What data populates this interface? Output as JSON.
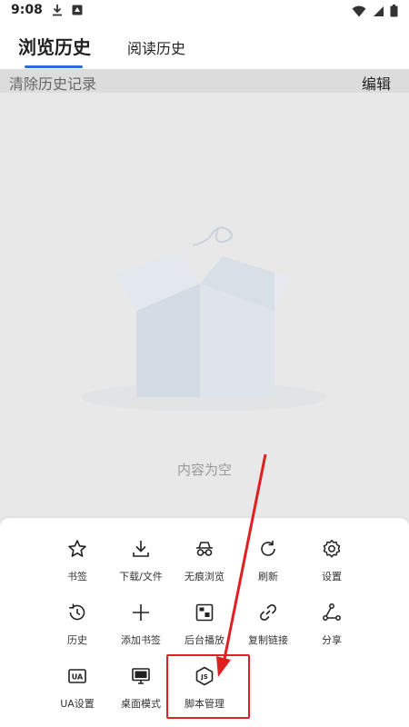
{
  "status_bar": {
    "time": "9:08"
  },
  "tabs": [
    {
      "label": "浏览历史",
      "active": true
    },
    {
      "label": "阅读历史",
      "active": false
    }
  ],
  "actionbar": {
    "clear_label": "清除历史记录",
    "edit_label": "编辑"
  },
  "empty_state": {
    "text": "内容为空"
  },
  "menu": {
    "items": [
      {
        "label": "书签",
        "icon": "star-icon"
      },
      {
        "label": "下载/文件",
        "icon": "download-icon"
      },
      {
        "label": "无痕浏览",
        "icon": "incognito-icon"
      },
      {
        "label": "刷新",
        "icon": "refresh-icon"
      },
      {
        "label": "设置",
        "icon": "gear-icon"
      },
      {
        "label": "历史",
        "icon": "history-icon"
      },
      {
        "label": "添加书签",
        "icon": "plus-icon"
      },
      {
        "label": "后台播放",
        "icon": "background-play-icon"
      },
      {
        "label": "复制链接",
        "icon": "link-icon"
      },
      {
        "label": "分享",
        "icon": "share-icon"
      },
      {
        "label": "UA设置",
        "icon": "ua-icon"
      },
      {
        "label": "桌面模式",
        "icon": "desktop-icon"
      },
      {
        "label": "脚本管理",
        "icon": "js-icon"
      }
    ]
  },
  "colors": {
    "accent": "#2f6bd8",
    "highlight": "#e02020"
  }
}
